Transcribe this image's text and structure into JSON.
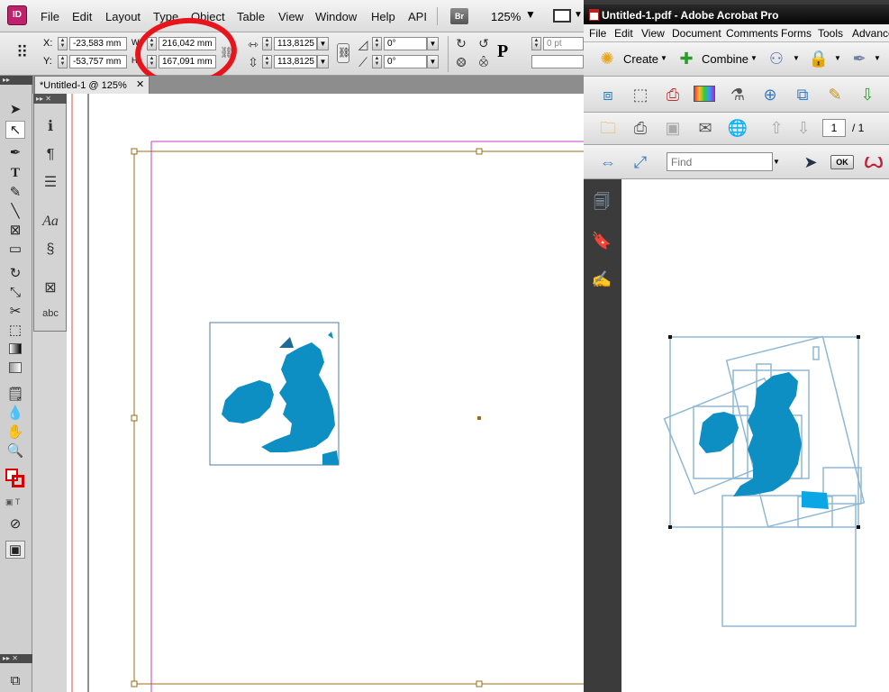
{
  "indesign": {
    "logo": "ID",
    "menu": [
      "File",
      "Edit",
      "Layout",
      "Type",
      "Object",
      "Table",
      "View",
      "Window",
      "Help",
      "API"
    ],
    "bridge_label": "Br",
    "zoom": "125%",
    "control": {
      "x_label": "X:",
      "x_value": "-23,583 mm",
      "y_label": "Y:",
      "y_value": "-53,757 mm",
      "w_label": "W:",
      "w_value": "216,042 mm",
      "h_label": "H:",
      "h_value": "167,091 mm",
      "scale_x": "113,8125",
      "scale_y": "113,8125",
      "rotate": "0°",
      "shear": "0°",
      "stroke_weight": "0 pt"
    },
    "doc_tab": "*Untitled-1 @ 125%",
    "tools": [
      "selection-tool",
      "direct-selection-tool",
      "pen-tool",
      "type-tool",
      "pencil-tool",
      "line-tool",
      "rectangle-frame-tool",
      "rectangle-tool",
      "rotate-tool",
      "scale-tool",
      "scissors-tool",
      "free-transform-tool",
      "gradient-swatch-tool",
      "gradient-feather-tool",
      "note-tool",
      "eyedropper-tool",
      "hand-tool",
      "zoom-tool",
      "fill-stroke-swatch",
      "swap-icon",
      "preview-mode-icon"
    ],
    "panel_icons": [
      "info-icon",
      "paragraph-icon",
      "text-wrap-icon",
      "character-styles-icon",
      "effects-icon",
      "frame-fit-icon",
      "spelling-icon"
    ]
  },
  "acrobat": {
    "title": "Untitled-1.pdf - Adobe Acrobat Pro",
    "menu": [
      "File",
      "Edit",
      "View",
      "Document",
      "Comments",
      "Forms",
      "Tools",
      "Advance"
    ],
    "create_label": "Create",
    "combine_label": "Combine",
    "page_current": "1",
    "page_total": "/ 1",
    "find_placeholder": "Find",
    "ok_label": "OK"
  },
  "colors": {
    "map_blue": "#0e8fc4",
    "frame_brown": "#a06914",
    "margin_purple": "#c03ccc",
    "highlight_red": "#e8141c",
    "frame_lightblue": "#8fb8d4"
  }
}
